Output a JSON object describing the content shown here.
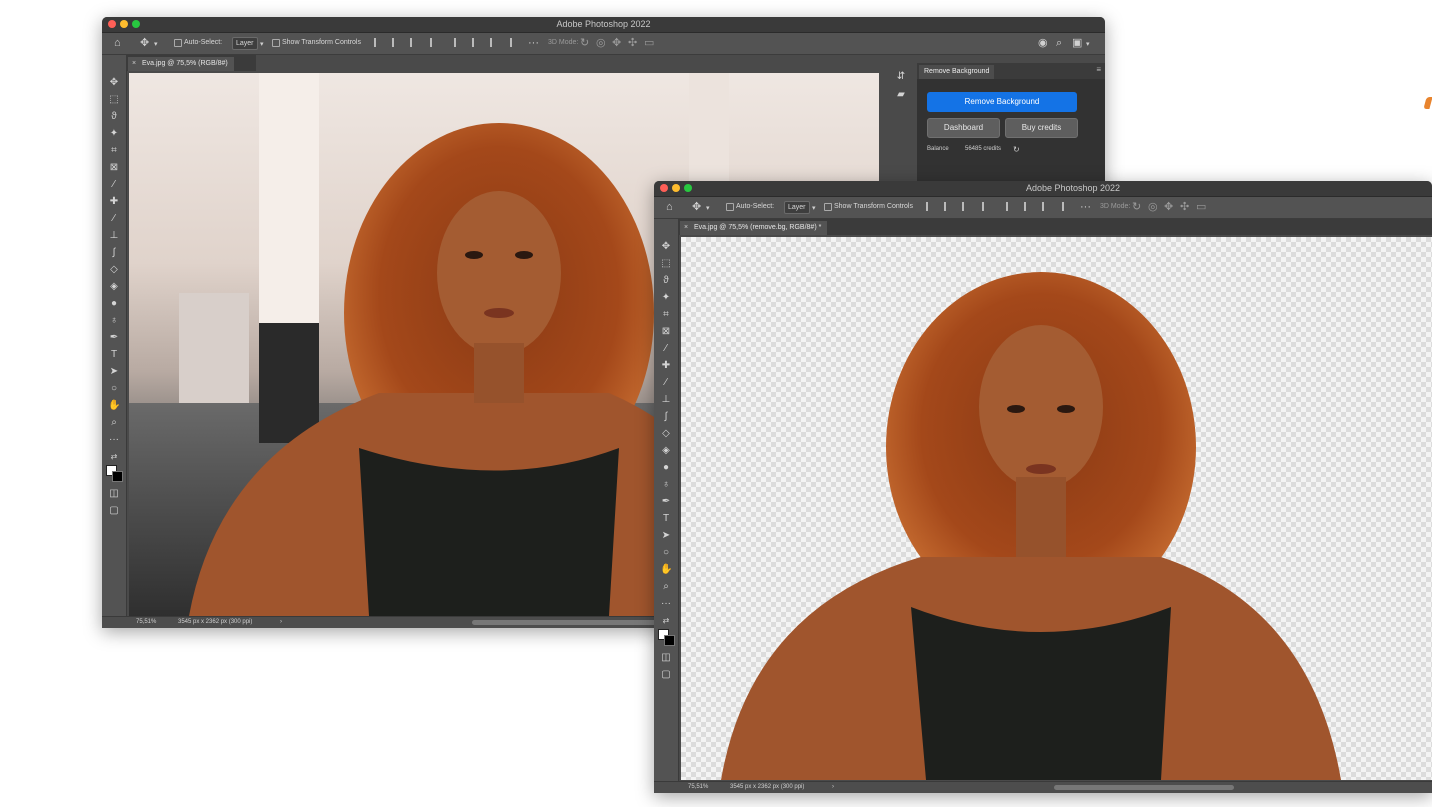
{
  "app": {
    "title": "Adobe Photoshop 2022"
  },
  "window_back": {
    "title": "Adobe Photoshop 2022",
    "tab_label": "Eva.jpg @ 75,5% (RGB/8#)",
    "status_zoom": "75,51%",
    "status_info": "3545 px x 2362 px (300 ppi)"
  },
  "window_front": {
    "title": "Adobe Photoshop 2022",
    "tab_label": "Eva.jpg @ 75,5% (remove.bg, RGB/8#) *",
    "status_zoom": "75,51%",
    "status_info": "3545 px x 2362 px (300 ppi)"
  },
  "options_bar": {
    "auto_select": "Auto-Select:",
    "layer_dropdown": "Layer",
    "show_transform": "Show Transform Controls",
    "mode_3d": "3D Mode:"
  },
  "plugin_panel": {
    "tab_title": "Remove Background",
    "remove_bg_button": "Remove Background",
    "dashboard_button": "Dashboard",
    "buy_credits_button": "Buy credits",
    "balance_label": "Balance",
    "balance_value": "56485 credits"
  },
  "colors": {
    "accent_blue": "#1473e6",
    "ui_dark": "#535353",
    "orange_accent": "#e8842e"
  }
}
